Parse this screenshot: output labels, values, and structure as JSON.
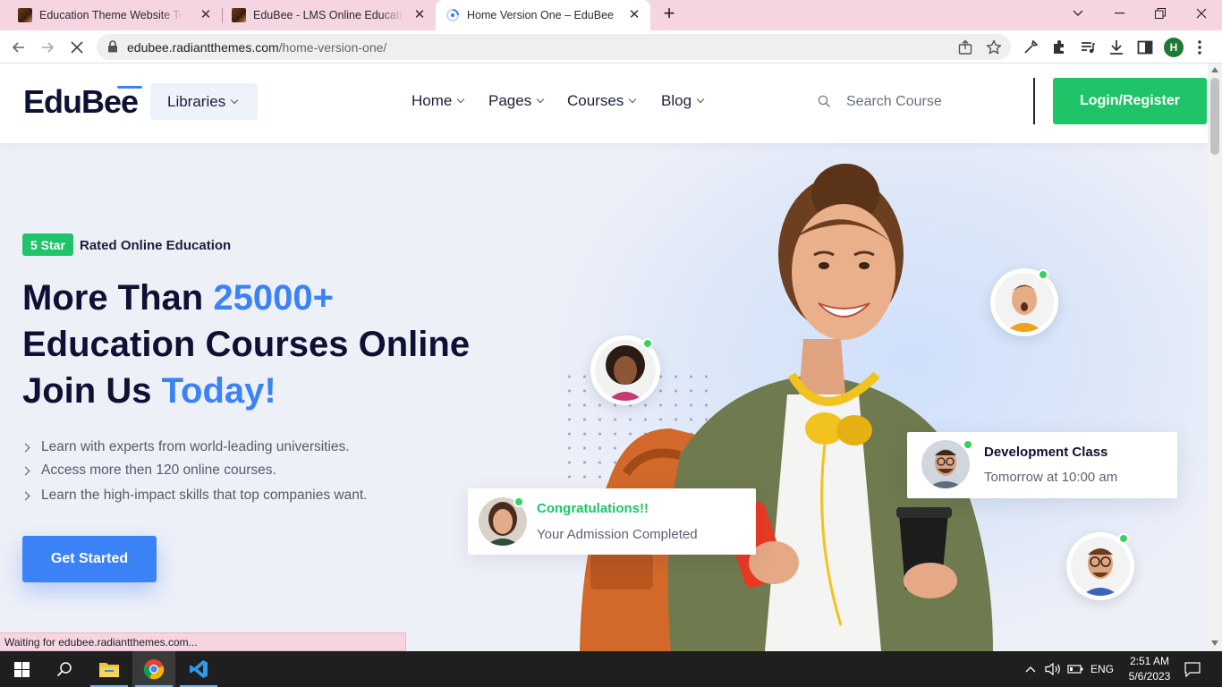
{
  "browser": {
    "tabs": [
      {
        "title": "Education Theme Website Templ",
        "active": false
      },
      {
        "title": "EduBee - LMS Online Education T",
        "active": false
      },
      {
        "title": "Home Version One – EduBee",
        "active": true
      }
    ],
    "url_domain": "edubee.radiantthemes.com",
    "url_path": "/home-version-one/",
    "profile_initial": "H",
    "status_text": "Waiting for edubee.radiantthemes.com..."
  },
  "site": {
    "logo": "EduBee",
    "libraries_label": "Libraries",
    "nav": [
      "Home",
      "Pages",
      "Courses",
      "Blog"
    ],
    "search_placeholder": "Search Course",
    "login_label": "Login/Register",
    "accent": "#3b82f6",
    "green": "#1ec467"
  },
  "hero": {
    "badge_star": "5 Star",
    "badge_text": "Rated Online Education",
    "line1_pre": "More Than ",
    "line1_hl": "25000+",
    "line2": "Education Courses Online",
    "line3_pre": "Join Us ",
    "line3_hl": "Today!",
    "features": [
      "Learn with experts from world-leading universities.",
      "Access more then 120 online courses.",
      "Learn the high-impact skills that top companies want."
    ],
    "cta": "Get Started"
  },
  "cards": {
    "congrats_title": "Congratulations!!",
    "congrats_sub": "Your Admission Completed",
    "dev_title": "Development Class",
    "dev_sub": "Tomorrow at 10:00 am"
  },
  "taskbar": {
    "time": "2:51 AM",
    "date": "5/6/2023",
    "lang": "ENG"
  }
}
